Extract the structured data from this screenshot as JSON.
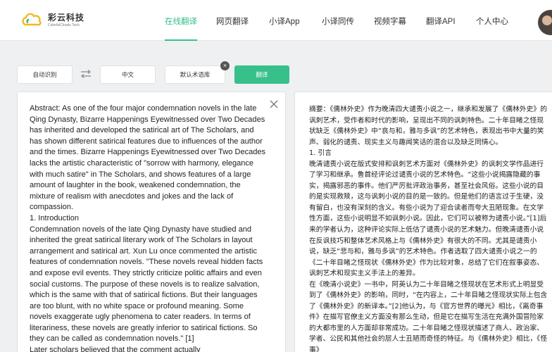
{
  "header": {
    "logo": {
      "name": "彩云科技",
      "subtitle": "ColorfulClouds Tech."
    },
    "nav": [
      {
        "label": "在线翻译",
        "active": true
      },
      {
        "label": "网页翻译"
      },
      {
        "label": "小译App"
      },
      {
        "label": "小译同传"
      },
      {
        "label": "视频字幕"
      },
      {
        "label": "翻译API"
      },
      {
        "label": "个人中心"
      }
    ]
  },
  "toolbar": {
    "source_lang": "自动识别",
    "swap_icon": "swap-arrows-icon",
    "target_lang": "中文",
    "term_base": "默认术语库",
    "term_clear": "×",
    "translate_label": "翻译"
  },
  "colors": {
    "accent": "#37c08a",
    "nav_active": "#37c08a"
  },
  "source": {
    "close_icon": "close-x-icon",
    "paragraphs": [
      "Abstract: As one of the four major condemnation novels in the late Qing Dynasty, Bizarre Happenings Eyewitnessed over Two Decades has inherited and developed the satirical art of The Scholars, and has shown different satirical features due to influences of the author and the times. Bizarre Happenings Eyewitnessed over Two Decades lacks the artistic characteristic of \"sorrow with harmony, elegance with much satire\" in The Scholars, and shows features of a large amount of laughter in the book, weakened condemnation, the mixture of realism with anecdotes and jokes and the lack of compassion.",
      "1. Introduction",
      "Condemnation novels of the late Qing Dynasty have studied and inherited the great satirical literary work of The Scholars in layout arrangement and satirical art. Xun Lu once commented the artistic features of condemnation novels. \"These novels reveal hidden facts and expose evil events. They strictly criticize politic affairs and even social customs. The purpose of these novels is to realize salvation, which is the same with that of satirical fictions. But their languages are too blunt, with no white space or profound meaning. Some novels exaggerate ugly phenomena to cater readers. In terms of literariness, these novels are greatly inferior to satirical fictions. So they can be called as condemnation novels.\" [1]",
      "Later scholars believed that the comment actually"
    ]
  },
  "target": {
    "paragraphs": [
      "摘要：《儒林外史》作为晚清四大谴责小说之一，继承和发展了《儒林外史》的讽刺艺术，受作者和时代的影响，呈现出不同的讽刺特色。二十年目睹之怪现状缺乏《儒林外史》中“哀与和，雅与多讽”的艺术特色，表现出书中大量的笑声、弱化的谴责、现实主义与趣闻笑话的混合以及缺乏同情心。",
      "1. 引言",
      "晚清谴责小说在版式安排和讽刺艺术方面对《儒林外史》的讽刺文学作品进行了学习和继承。鲁首经评论过谴责小说的艺术特色。“这些小说揭露隐藏的事实，揭露邪恶的事件。他们严厉批评政治事务，甚至社会风俗。这些小说的目的是实现救赎，这与讽刺小说的目的是一致的。但是他们的语言过于生硬，没有留白，也没有深刻的含义。有些小说为了迎合读者而夸大丑陋现象。在文学性方面，这些小说明显不如讽刺小说。因此，它们可以被称为谴责小说。”[1]后来的学者认为，这种评论实际上低估了谴责小说的艺术魅力。但晚清谴责小说在反讽技巧和整体艺术风格上与《儒林外史》有很大的不同。尤其是谴责小说，缺乏“悲与和，雅与多讽”的艺术特色。作者选取了四大谴责小说之一的《二十年目睹之怪现状《儒林外史》作为比较对象，总结了它们在叙事姿态、讽刺艺术和现实主义手法上的差异。",
      "在《晚清小说史》一书中，阿英认为二十年目睹之怪现状在艺术形式上明显受到了《儒林外史》的影响，同时，“在内容上，二十年目睹之怪现状实际上包含了《儒林外史》的新译本。”[2]他认为，与《官方世界的曝光》相比，《离奇事件》在描写官僚主义方面没有那么生动，但是它在描写生活在充满外国冒险家的大都市里的人方面却非常成功。二十年目睹之怪现状描述了商人、政治家、学者、公民和其他社会的层人士丑陋而奇怪的特征。与《儒林外史》相比，《怪事》"
    ]
  }
}
